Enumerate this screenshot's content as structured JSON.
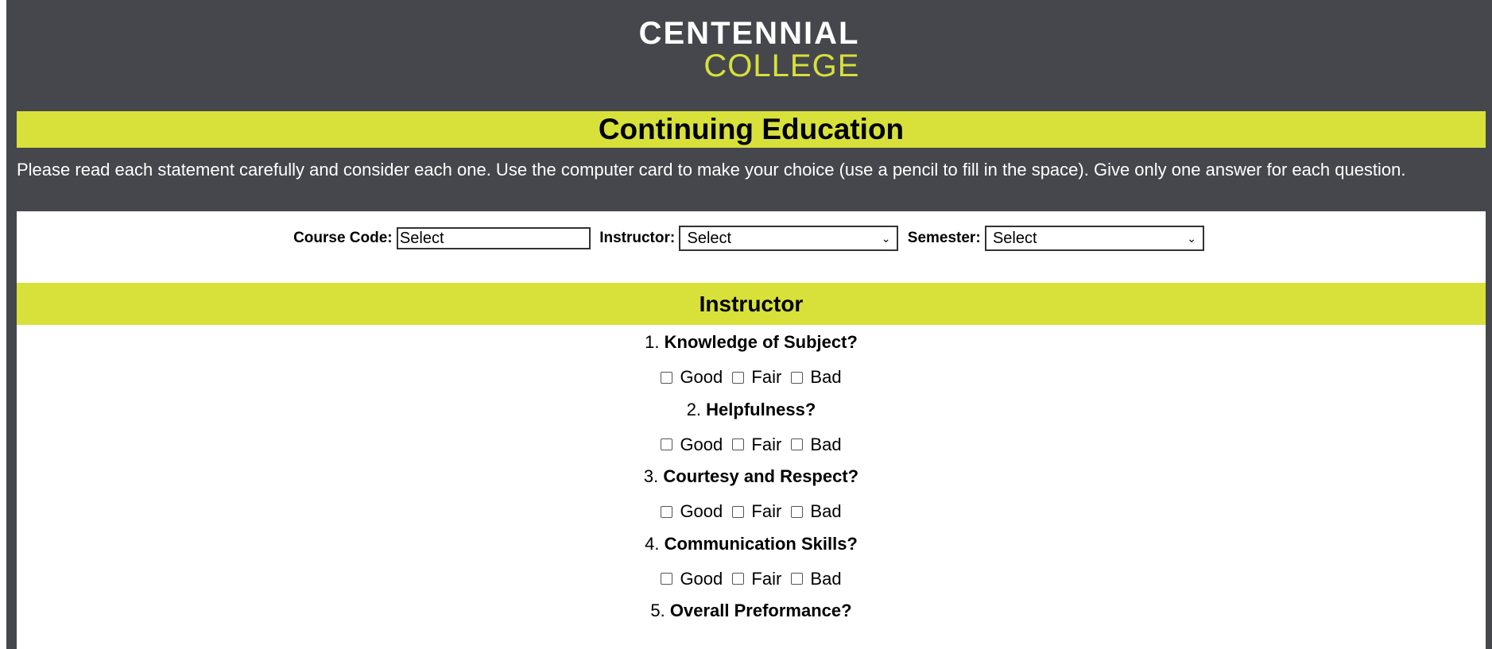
{
  "logo": {
    "line1": "CENTENNIAL",
    "line2": "COLLEGE"
  },
  "banner_title": "Continuing Education",
  "intro_text": "Please read each statement carefully and consider each one. Use the computer card to make your choice (use a pencil to fill in the space). Give only one answer for each question.",
  "filters": {
    "course_code_label": "Course Code:",
    "course_code_value": "Select",
    "instructor_label": "Instructor:",
    "instructor_value": "Select",
    "semester_label": "Semester:",
    "semester_value": "Select"
  },
  "section_title": "Instructor",
  "questions": [
    {
      "num": "1.",
      "text": "Knowledge of Subject?"
    },
    {
      "num": "2.",
      "text": "Helpfulness?"
    },
    {
      "num": "3.",
      "text": "Courtesy and Respect?"
    },
    {
      "num": "4.",
      "text": "Communication Skills?"
    },
    {
      "num": "5.",
      "text": "Overall Preformance?"
    }
  ],
  "options": [
    "Good",
    "Fair",
    "Bad"
  ],
  "colors": {
    "header_bg": "#46474c",
    "accent": "#d7e13a"
  }
}
